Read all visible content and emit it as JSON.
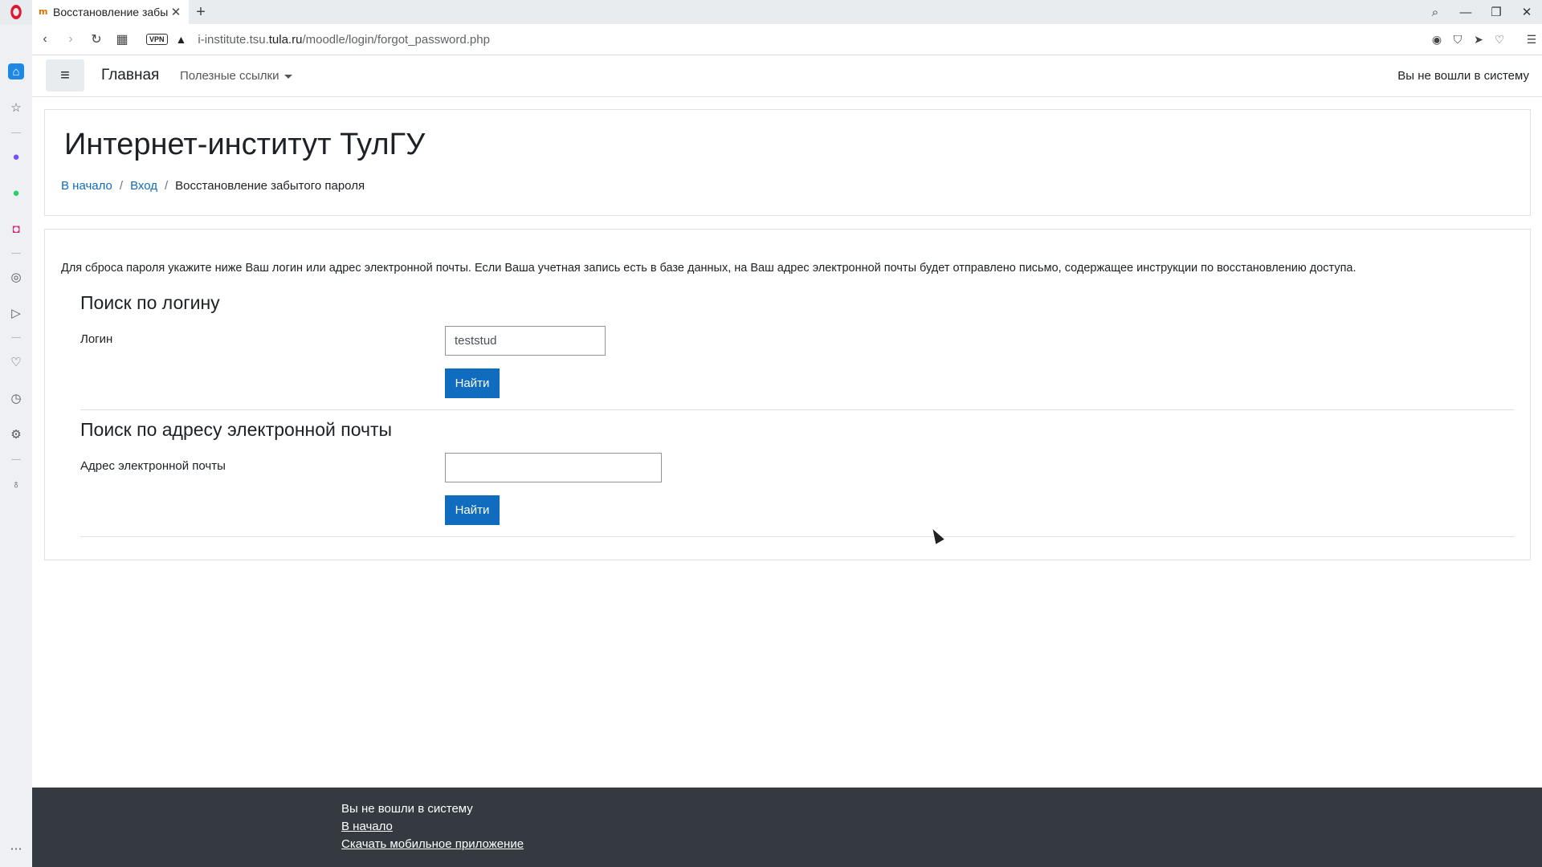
{
  "browser": {
    "tab_title": "Восстановление забы",
    "favicon_glyph": "m",
    "url_prefix": "i-institute.tsu.",
    "url_domain": "tula.ru",
    "url_path": "/moodle/login/forgot_password.php",
    "vpn_label": "VPN"
  },
  "navbar": {
    "brand": "Главная",
    "useful_links": "Полезные ссылки",
    "not_logged_in": "Вы не вошли в систему"
  },
  "header": {
    "title": "Интернет-институт ТулГУ",
    "breadcrumb": [
      "В начало",
      "Вход",
      "Восстановление забытого пароля"
    ]
  },
  "main": {
    "instructions": "Для сброса пароля укажите ниже Ваш логин или адрес электронной почты. Если Ваша учетная запись есть в базе данных, на Ваш адрес электронной почты будет отправлено письмо, содержащее инструкции по восстановлению доступа.",
    "login_section": {
      "title": "Поиск по логину",
      "label": "Логин",
      "value": "teststud",
      "button": "Найти"
    },
    "email_section": {
      "title": "Поиск по адресу электронной почты",
      "label": "Адрес электронной почты",
      "value": "",
      "button": "Найти"
    }
  },
  "footer": {
    "not_logged_in": "Вы не вошли в систему",
    "home_link": "В начало",
    "mobile_app_link": "Скачать мобильное приложение"
  },
  "colors": {
    "primary": "#0f6cbf",
    "footer_bg": "#343a40"
  }
}
